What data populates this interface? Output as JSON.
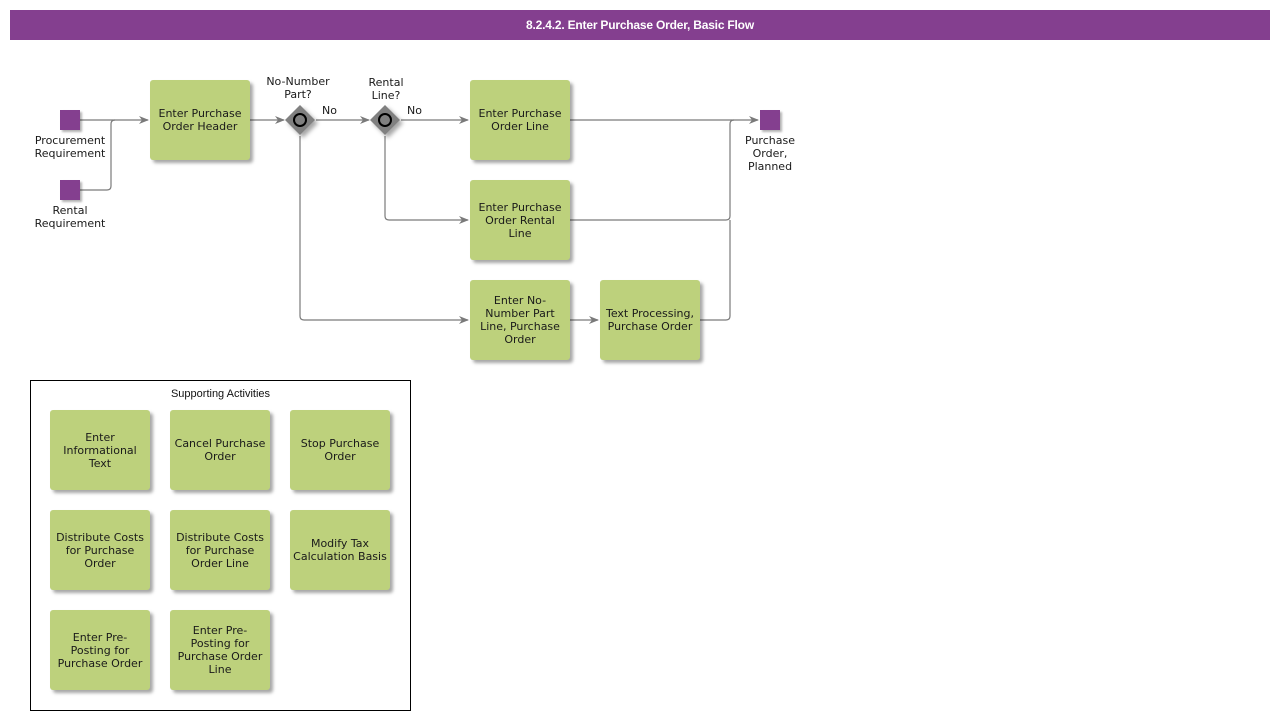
{
  "header": {
    "title": "8.2.4.2. Enter Purchase Order, Basic Flow"
  },
  "colors": {
    "header_bg": "#843f8f",
    "event": "#843f8f",
    "task": "#bdd17c",
    "gateway": "#808080",
    "connector": "#7a7a7a"
  },
  "events": {
    "procurement_requirement": {
      "label": "Procurement Requirement",
      "lines": [
        "Procurement",
        "Requirement"
      ],
      "type": "start"
    },
    "rental_requirement": {
      "label": "Rental Requirement",
      "lines": [
        "Rental",
        "Requirement"
      ],
      "type": "start"
    },
    "purchase_order_planned": {
      "label": "Purchase Order, Planned",
      "lines": [
        "Purchase",
        "Order,",
        "Planned"
      ],
      "type": "end"
    }
  },
  "gateways": {
    "no_number_part": {
      "label": "No-Number Part?",
      "lines": [
        "No-Number",
        "Part?"
      ],
      "outgoing_label": "No"
    },
    "rental_line": {
      "label": "Rental Line?",
      "lines": [
        "Rental",
        "Line?"
      ],
      "outgoing_label": "No"
    }
  },
  "tasks": {
    "enter_po_header": "Enter Purchase Order Header",
    "enter_po_line": "Enter Purchase Order Line",
    "enter_po_rental_line": "Enter Purchase Order Rental Line",
    "enter_no_number_part_line": "Enter No-Number Part Line, Purchase Order",
    "text_processing": "Text Processing, Purchase Order"
  },
  "supporting": {
    "title": "Supporting Activities",
    "items": [
      "Enter Informational Text",
      "Cancel Purchase Order",
      "Stop Purchase Order",
      "Distribute Costs for Purchase Order",
      "Distribute Costs for Purchase Order Line",
      "Modify Tax Calculation Basis",
      "Enter Pre-Posting for Purchase Order",
      "Enter Pre-Posting for Purchase Order Line"
    ]
  },
  "flows": [
    {
      "from": "procurement_requirement",
      "to": "enter_po_header"
    },
    {
      "from": "rental_requirement",
      "to": "enter_po_header"
    },
    {
      "from": "enter_po_header",
      "to": "no_number_part"
    },
    {
      "from": "no_number_part",
      "to": "rental_line",
      "label": "No"
    },
    {
      "from": "no_number_part",
      "to": "enter_no_number_part_line"
    },
    {
      "from": "rental_line",
      "to": "enter_po_line",
      "label": "No"
    },
    {
      "from": "rental_line",
      "to": "enter_po_rental_line"
    },
    {
      "from": "enter_no_number_part_line",
      "to": "text_processing"
    },
    {
      "from": "enter_po_line",
      "to": "purchase_order_planned"
    },
    {
      "from": "enter_po_rental_line",
      "to": "purchase_order_planned"
    },
    {
      "from": "text_processing",
      "to": "purchase_order_planned"
    }
  ]
}
